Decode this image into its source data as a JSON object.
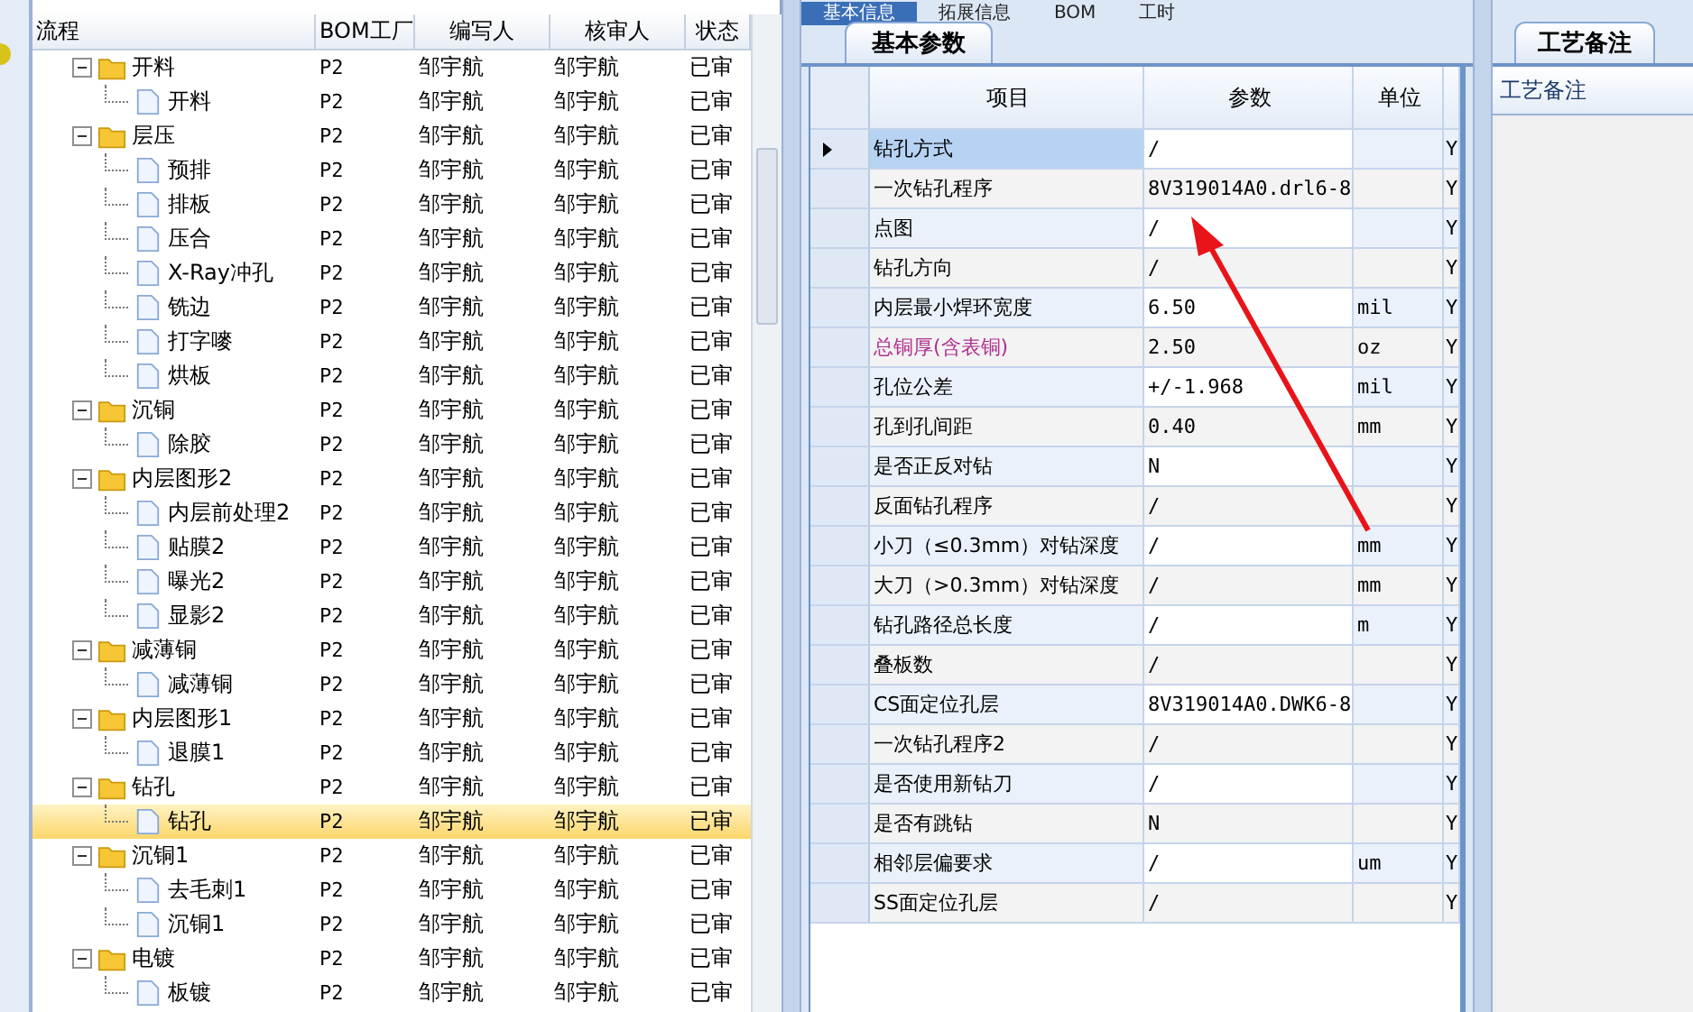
{
  "tree_grid": {
    "columns": [
      "流程",
      "BOM工厂",
      "编写人",
      "核审人",
      "状态"
    ],
    "nodes": [
      {
        "name": "开料",
        "factory": "P2",
        "writer": "邹宇航",
        "reviewer": "邹宇航",
        "status": "已审",
        "expanded": true,
        "selected": false,
        "children": [
          {
            "name": "开料",
            "factory": "P2",
            "writer": "邹宇航",
            "reviewer": "邹宇航",
            "status": "已审",
            "selected": false
          }
        ]
      },
      {
        "name": "层压",
        "factory": "P2",
        "writer": "邹宇航",
        "reviewer": "邹宇航",
        "status": "已审",
        "expanded": true,
        "selected": false,
        "children": [
          {
            "name": "预排",
            "factory": "P2",
            "writer": "邹宇航",
            "reviewer": "邹宇航",
            "status": "已审",
            "selected": false
          },
          {
            "name": "排板",
            "factory": "P2",
            "writer": "邹宇航",
            "reviewer": "邹宇航",
            "status": "已审",
            "selected": false
          },
          {
            "name": "压合",
            "factory": "P2",
            "writer": "邹宇航",
            "reviewer": "邹宇航",
            "status": "已审",
            "selected": false
          },
          {
            "name": "X-Ray冲孔",
            "factory": "P2",
            "writer": "邹宇航",
            "reviewer": "邹宇航",
            "status": "已审",
            "selected": false
          },
          {
            "name": "铣边",
            "factory": "P2",
            "writer": "邹宇航",
            "reviewer": "邹宇航",
            "status": "已审",
            "selected": false
          },
          {
            "name": "打字嘜",
            "factory": "P2",
            "writer": "邹宇航",
            "reviewer": "邹宇航",
            "status": "已审",
            "selected": false
          },
          {
            "name": "烘板",
            "factory": "P2",
            "writer": "邹宇航",
            "reviewer": "邹宇航",
            "status": "已审",
            "selected": false
          }
        ]
      },
      {
        "name": "沉铜",
        "factory": "P2",
        "writer": "邹宇航",
        "reviewer": "邹宇航",
        "status": "已审",
        "expanded": true,
        "selected": false,
        "children": [
          {
            "name": "除胶",
            "factory": "P2",
            "writer": "邹宇航",
            "reviewer": "邹宇航",
            "status": "已审",
            "selected": false
          }
        ]
      },
      {
        "name": "内层图形2",
        "factory": "P2",
        "writer": "邹宇航",
        "reviewer": "邹宇航",
        "status": "已审",
        "expanded": true,
        "selected": false,
        "children": [
          {
            "name": "内层前处理2",
            "factory": "P2",
            "writer": "邹宇航",
            "reviewer": "邹宇航",
            "status": "已审",
            "selected": false
          },
          {
            "name": "贴膜2",
            "factory": "P2",
            "writer": "邹宇航",
            "reviewer": "邹宇航",
            "status": "已审",
            "selected": false
          },
          {
            "name": "曝光2",
            "factory": "P2",
            "writer": "邹宇航",
            "reviewer": "邹宇航",
            "status": "已审",
            "selected": false
          },
          {
            "name": "显影2",
            "factory": "P2",
            "writer": "邹宇航",
            "reviewer": "邹宇航",
            "status": "已审",
            "selected": false
          }
        ]
      },
      {
        "name": "减薄铜",
        "factory": "P2",
        "writer": "邹宇航",
        "reviewer": "邹宇航",
        "status": "已审",
        "expanded": true,
        "selected": false,
        "children": [
          {
            "name": "减薄铜",
            "factory": "P2",
            "writer": "邹宇航",
            "reviewer": "邹宇航",
            "status": "已审",
            "selected": false
          }
        ]
      },
      {
        "name": "内层图形1",
        "factory": "P2",
        "writer": "邹宇航",
        "reviewer": "邹宇航",
        "status": "已审",
        "expanded": true,
        "selected": false,
        "children": [
          {
            "name": "退膜1",
            "factory": "P2",
            "writer": "邹宇航",
            "reviewer": "邹宇航",
            "status": "已审",
            "selected": false
          }
        ]
      },
      {
        "name": "钻孔",
        "factory": "P2",
        "writer": "邹宇航",
        "reviewer": "邹宇航",
        "status": "已审",
        "expanded": true,
        "selected": false,
        "children": [
          {
            "name": "钻孔",
            "factory": "P2",
            "writer": "邹宇航",
            "reviewer": "邹宇航",
            "status": "已审",
            "selected": true
          }
        ]
      },
      {
        "name": "沉铜1",
        "factory": "P2",
        "writer": "邹宇航",
        "reviewer": "邹宇航",
        "status": "已审",
        "expanded": true,
        "selected": false,
        "children": [
          {
            "name": "去毛刺1",
            "factory": "P2",
            "writer": "邹宇航",
            "reviewer": "邹宇航",
            "status": "已审",
            "selected": false
          },
          {
            "name": "沉铜1",
            "factory": "P2",
            "writer": "邹宇航",
            "reviewer": "邹宇航",
            "status": "已审",
            "selected": false
          }
        ]
      },
      {
        "name": "电镀",
        "factory": "P2",
        "writer": "邹宇航",
        "reviewer": "邹宇航",
        "status": "已审",
        "expanded": true,
        "selected": false,
        "children": [
          {
            "name": "板镀",
            "factory": "P2",
            "writer": "邹宇航",
            "reviewer": "邹宇航",
            "status": "已审",
            "selected": false
          }
        ]
      }
    ]
  },
  "top_tabs": [
    {
      "label": "基本信息",
      "selected": true
    },
    {
      "label": "拓展信息",
      "selected": false
    },
    {
      "label": "BOM",
      "selected": false
    },
    {
      "label": "工时",
      "selected": false
    }
  ],
  "param_panel": {
    "tab": "基本参数",
    "columns": [
      "项目",
      "参数",
      "单位"
    ],
    "rows": [
      {
        "item": "钻孔方式",
        "value": "/",
        "unit": "",
        "column_5": "Y",
        "selected": true,
        "emphasized": false
      },
      {
        "item": "一次钻孔程序",
        "value": "8V319014A0.drl6-8",
        "unit": "",
        "column_5": "Y",
        "selected": false,
        "emphasized": false
      },
      {
        "item": "点图",
        "value": "/",
        "unit": "",
        "column_5": "Y",
        "selected": false,
        "emphasized": false
      },
      {
        "item": "钻孔方向",
        "value": "/",
        "unit": "",
        "column_5": "Y",
        "selected": false,
        "emphasized": false
      },
      {
        "item": "内层最小焊环宽度",
        "value": "6.50",
        "unit": "mil",
        "column_5": "Y",
        "selected": false,
        "emphasized": false
      },
      {
        "item": "总铜厚(含表铜)",
        "value": "2.50",
        "unit": "oz",
        "column_5": "Y",
        "selected": false,
        "emphasized": true
      },
      {
        "item": "孔位公差",
        "value": "+/-1.968",
        "unit": "mil",
        "column_5": "Y",
        "selected": false,
        "emphasized": false
      },
      {
        "item": "孔到孔间距",
        "value": "0.40",
        "unit": "mm",
        "column_5": "Y",
        "selected": false,
        "emphasized": false
      },
      {
        "item": "是否正反对钻",
        "value": "N",
        "unit": "",
        "column_5": "Y",
        "selected": false,
        "emphasized": false
      },
      {
        "item": "反面钻孔程序",
        "value": "/",
        "unit": "",
        "column_5": "Y",
        "selected": false,
        "emphasized": false
      },
      {
        "item": "小刀（≤0.3mm）对钻深度",
        "value": "/",
        "unit": "mm",
        "column_5": "Y",
        "selected": false,
        "emphasized": false
      },
      {
        "item": "大刀（>0.3mm）对钻深度",
        "value": "/",
        "unit": "mm",
        "column_5": "Y",
        "selected": false,
        "emphasized": false
      },
      {
        "item": "钻孔路径总长度",
        "value": "/",
        "unit": "m",
        "column_5": "Y",
        "selected": false,
        "emphasized": false
      },
      {
        "item": "叠板数",
        "value": "/",
        "unit": "",
        "column_5": "Y",
        "selected": false,
        "emphasized": false
      },
      {
        "item": "CS面定位孔层",
        "value": "8V319014A0.DWK6-8",
        "unit": "",
        "column_5": "Y",
        "selected": false,
        "emphasized": false
      },
      {
        "item": "一次钻孔程序2",
        "value": "/",
        "unit": "",
        "column_5": "Y",
        "selected": false,
        "emphasized": false
      },
      {
        "item": "是否使用新钻刀",
        "value": "/",
        "unit": "",
        "column_5": "Y",
        "selected": false,
        "emphasized": false
      },
      {
        "item": "是否有跳钻",
        "value": "N",
        "unit": "",
        "column_5": "Y",
        "selected": false,
        "emphasized": false
      },
      {
        "item": "相邻层偏要求",
        "value": "/",
        "unit": "um",
        "column_5": "Y",
        "selected": false,
        "emphasized": false
      },
      {
        "item": "SS面定位孔层",
        "value": "/",
        "unit": "",
        "column_5": "Y",
        "selected": false,
        "emphasized": false
      }
    ]
  },
  "notes_panel": {
    "tab": "工艺备注",
    "header": "工艺备注"
  }
}
